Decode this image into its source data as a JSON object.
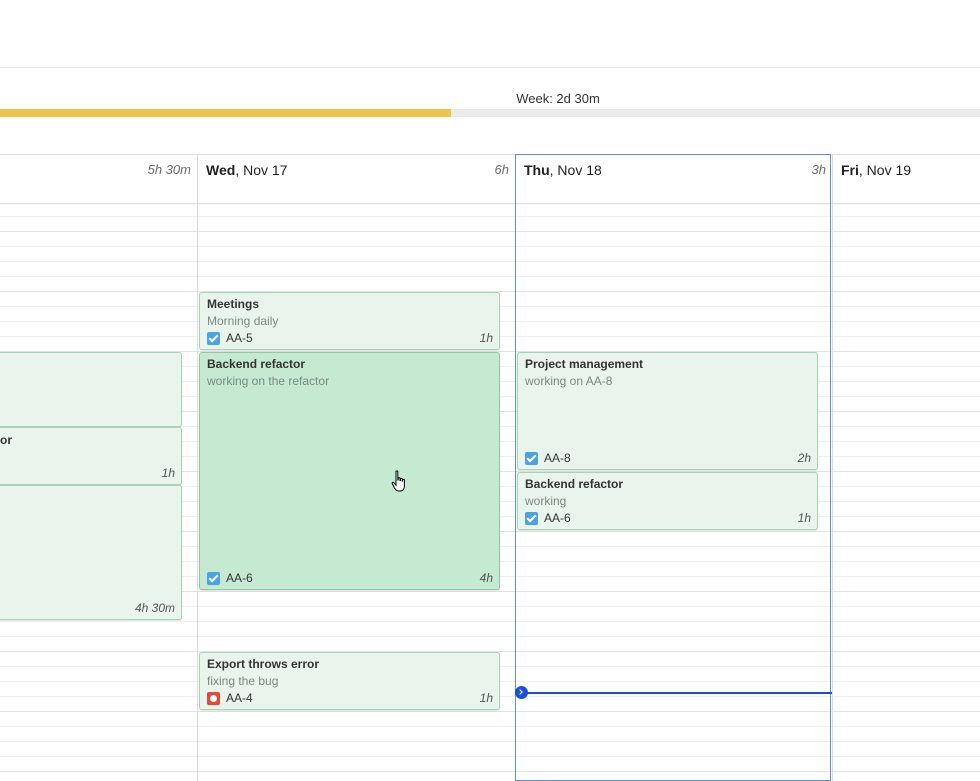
{
  "week": {
    "label": "Week: 2d 30m",
    "progress": 0.46
  },
  "days": [
    {
      "name": "",
      "date": "",
      "total": "5h 30m"
    },
    {
      "name": "Wed",
      "date": ", Nov 17",
      "total": "6h"
    },
    {
      "name": "Thu",
      "date": ", Nov 18",
      "total": "3h"
    },
    {
      "name": "Fri",
      "date": ", Nov 19",
      "total": ""
    }
  ],
  "events": {
    "tue_a": {
      "title": "",
      "desc": "",
      "issue": "",
      "dur": ""
    },
    "tue_b": {
      "title": "or",
      "desc": "",
      "issue": "",
      "dur": "1h"
    },
    "tue_c": {
      "title": "",
      "desc": "",
      "issue": "",
      "dur": "4h 30m"
    },
    "wed_meetings": {
      "title": "Meetings",
      "desc": "Morning daily",
      "issue": "AA-5",
      "dur": "1h"
    },
    "wed_backend": {
      "title": "Backend refactor",
      "desc": "working on the refactor",
      "issue": "AA-6",
      "dur": "4h"
    },
    "wed_export": {
      "title": "Export throws error",
      "desc": "fixing the bug",
      "issue": "AA-4",
      "dur": "1h"
    },
    "thu_pm": {
      "title": "Project management",
      "desc": "working on AA-8",
      "issue": "AA-8",
      "dur": "2h"
    },
    "thu_backend": {
      "title": "Backend refactor",
      "desc": "working",
      "issue": "AA-6",
      "dur": "1h"
    }
  },
  "icons": {
    "task": "task-check-icon",
    "bug": "bug-icon"
  },
  "colors": {
    "progress": "#f0c348",
    "event_bg": "#e8f4ec",
    "event_active": "#c6e9d2",
    "today_border": "#5b8fd6",
    "now_line": "#1a4fd6"
  }
}
